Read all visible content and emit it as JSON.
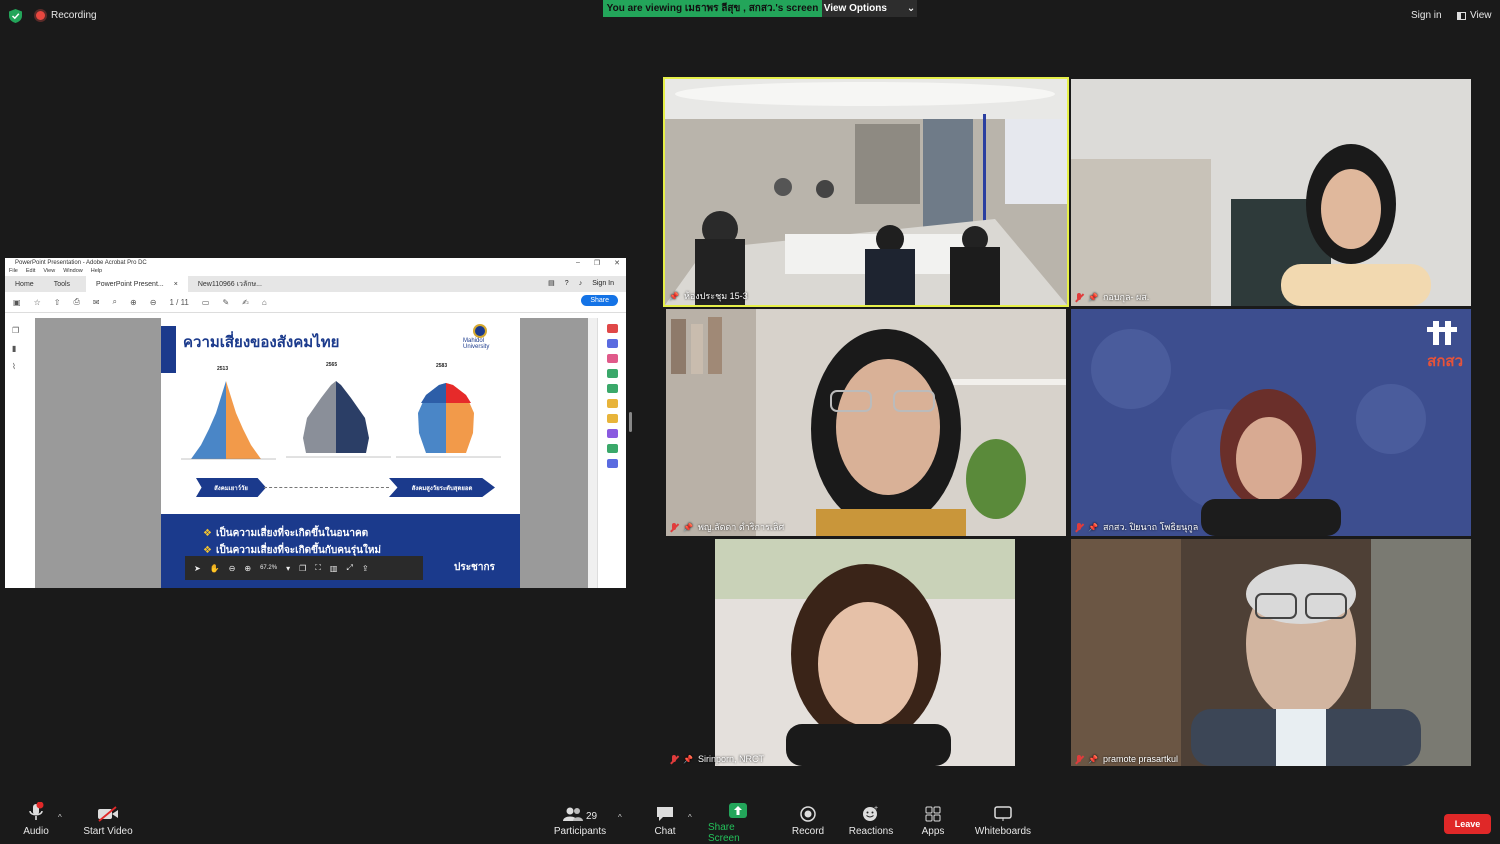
{
  "topbar": {
    "recording_label": "Recording",
    "viewing_banner": "You are viewing เมธาพร ลีสุข , สกสว.'s screen",
    "view_options_label": "View Options",
    "sign_in_label": "Sign in",
    "view_label": "View"
  },
  "shared": {
    "window_title": "PowerPoint Presentation - Adobe Acrobat Pro DC",
    "menu": [
      "File",
      "Edit",
      "View",
      "Window",
      "Help"
    ],
    "nav_home": "Home",
    "nav_tools": "Tools",
    "tab_active": "PowerPoint Present...",
    "tab_close": "×",
    "tab_second": "New110966 เวลักษ...",
    "sign_in": "Sign In",
    "page_current": "1",
    "page_total": "/ 11",
    "share_button": "Share",
    "zoom_value": "67.2%",
    "slide": {
      "title": "ความเสี่ยงของสังคมไทย",
      "logo_line1": "Mahidol",
      "logo_line2": "University",
      "year_1": "2513",
      "year_2": "2565",
      "year_3": "2583",
      "arrow_left": "สังคมเยาว์วัย",
      "arrow_right": "สังคมสูงวัยระดับสุดยอด",
      "bullet_1": "เป็นความเสี่ยงที่จะเกิดขึ้นในอนาคต",
      "bullet_2": "เป็นความเสี่ยงที่จะเกิดขึ้นกับคนรุ่นใหม่",
      "bullet_3_tail": "ประชากร"
    }
  },
  "participants_gallery": [
    {
      "name": "ห้องประชุม 15-3"
    },
    {
      "name": "กอบกุล- ผส."
    },
    {
      "name": "พญ.ลัดดา  ดำริการเลิศ"
    },
    {
      "name": "สกสว. ปิยนาถ  โพธิยนุกูล"
    },
    {
      "name": "Sirinporn, NRCT"
    },
    {
      "name": "pramote prasartkul"
    }
  ],
  "tile_logo_text": "สกสว",
  "bottombar": {
    "audio": "Audio",
    "start_video": "Start Video",
    "participants": "Participants",
    "participants_count": "29",
    "chat": "Chat",
    "share_screen": "Share Screen",
    "record": "Record",
    "reactions": "Reactions",
    "apps": "Apps",
    "whiteboards": "Whiteboards",
    "leave": "Leave"
  },
  "colors": {
    "share_green": "#23a55a",
    "leave_red": "#e02828",
    "active_speaker_border": "#e6f04a",
    "slide_blue": "#1b3a8c"
  }
}
